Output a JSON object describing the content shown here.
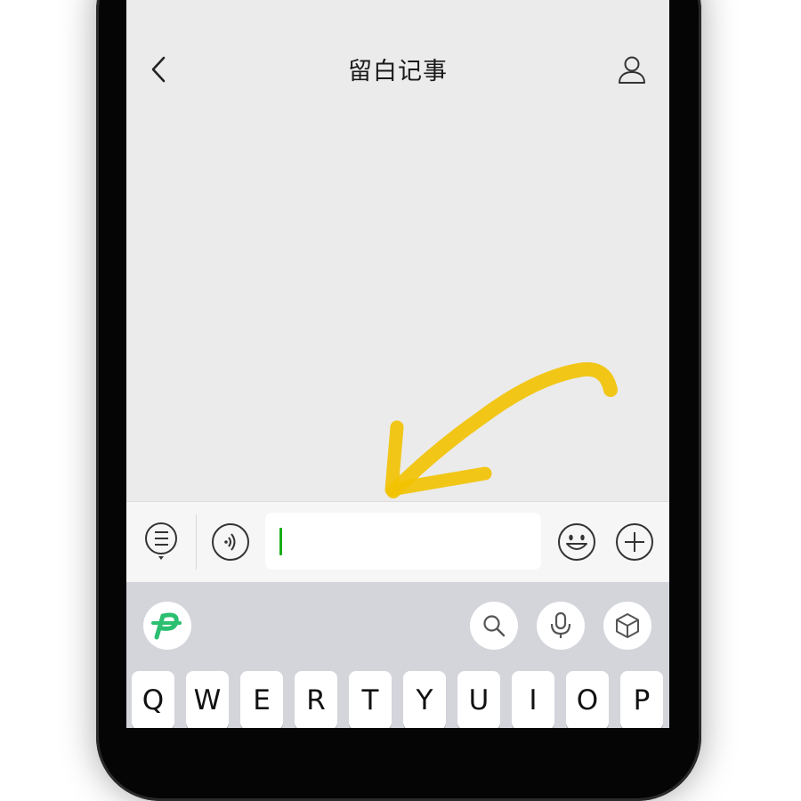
{
  "app": {
    "title": "留白记事"
  },
  "input": {
    "value": ""
  },
  "keyboard": {
    "row1": [
      "Q",
      "W",
      "E",
      "R",
      "T",
      "Y",
      "U",
      "I",
      "O",
      "P"
    ]
  },
  "colors": {
    "screen_bg": "#ebebeb",
    "caret": "#1aad19",
    "keyboard_bg": "#d3d5db",
    "logo_green": "#2bbf70",
    "annotation_arrow": "#f2c200"
  }
}
